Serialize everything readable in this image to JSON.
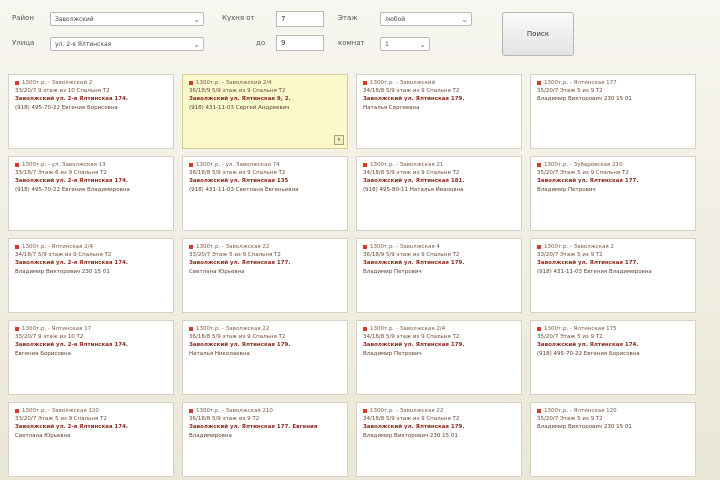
{
  "filters": {
    "row1_label": "Район",
    "row1_value": "Заволжский",
    "row2_label": "Улица",
    "row2_value": "ул. 2-я Ялтинская",
    "area_from_label": "Кухня от",
    "area_from_value": "7",
    "area_to_label": "до",
    "area_to_value": "9",
    "floor_label": "Этаж",
    "floor_value": "любой",
    "rooms_label": "комнат",
    "rooms_value": "1",
    "search_label": "Поиск"
  },
  "cards": [
    {
      "highlighted": false,
      "l1": "1300т.р. - Заволжский 2",
      "l2": "33/20/7 9 этаж из 10 Спальня Т2",
      "l3": "Заволжский ул. 2-я Ялтинская 174.",
      "l4": "(918) 495-70-22 Евгения Борисовна"
    },
    {
      "highlighted": true,
      "l1": "1300т.р. - Заволжский 2/4",
      "l2": "36/18/9 5/9 этаж из 9 Спальня Т2",
      "l3": "Заволжский ул. Ялтинская 9, 2.",
      "l4": "(918) 431-11-03 Сергей Андреевич"
    },
    {
      "highlighted": false,
      "l1": "1300т.р. - Заволжский",
      "l2": "34/18/8 5/9 этаж из 9 Спальня Т2",
      "l3": "Заволжский ул. Ялтинская 179.",
      "l4": "Наталья Сергеевна"
    },
    {
      "highlighted": false,
      "l1": "1300т.р. - Ялтинская 177",
      "l2": "35/20/7 Этаж 5 из 9 Т2",
      "l3": "",
      "l4": "Владимир Викторович 230 15 01"
    },
    {
      "highlighted": false,
      "l1": "1300т.р. - ул. Заволжская 13",
      "l2": "33/18/7 Этаж 6 из 9 Спальня Т2",
      "l3": "Заволжский ул. 2-я Ялтинская 174.",
      "l4": "(918) 495-70-22 Евгения Владимировна"
    },
    {
      "highlighted": false,
      "l1": "1300т.р. - ул. Заволжская 74",
      "l2": "36/18/8 5/9 этаж из 9 Спальня Т2",
      "l3": "Заволжский ул. Ялтинская 135",
      "l4": "(918) 431-11-03 Светлана Евгеньевна"
    },
    {
      "highlighted": false,
      "l1": "1300т.р. - Заволжская 21",
      "l2": "34/18/8 5/9 этаж из 9 Спальня Т2",
      "l3": "Заволжский ул. Ялтинская 181.",
      "l4": "(918) 495-80-11 Наталья Ивановна"
    },
    {
      "highlighted": false,
      "l1": "1300т.р. - Зубаровская 210",
      "l2": "35/20/7 Этаж 5 из 9 Спальня Т2",
      "l3": "Заволжский ул. Ялтинская 177.",
      "l4": "Владимир Петрович"
    },
    {
      "highlighted": false,
      "l1": "1300т.р. - Ялтинская 2/4",
      "l2": "34/18/7 5/9 этаж из 9 Спальня Т2",
      "l3": "Заволжский ул. 2-я Ялтинская 174.",
      "l4": "Владимир Викторович 230 15 01"
    },
    {
      "highlighted": false,
      "l1": "1300т.р. - Заволжская 22",
      "l2": "33/20/7 Этаж 5 из 9 Спальня Т2",
      "l3": "Заволжский ул. Ялтинская 177.",
      "l4": "Светлана Юрьевна"
    },
    {
      "highlighted": false,
      "l1": "1300т.р. - Заволжская 4",
      "l2": "36/18/9 5/9 этаж из 9 Спальня Т2",
      "l3": "Заволжский ул. Ялтинская 179.",
      "l4": "Владимир Петрович"
    },
    {
      "highlighted": false,
      "l1": "1300т.р. - Заволжская 2",
      "l2": "33/20/7 Этаж 5 из 9 Т2",
      "l3": "Заволжский ул. Ялтинская 177.",
      "l4": "(918) 431-11-03 Евгения Владимировна"
    },
    {
      "highlighted": false,
      "l1": "1300т.р. - Ялтинская 17",
      "l2": "33/20/7 9 этаж из 10 Т2",
      "l3": "Заволжский ул. 2-я Ялтинская 174.",
      "l4": "Евгения Борисовна"
    },
    {
      "highlighted": false,
      "l1": "1300т.р. - Заволжская 22",
      "l2": "36/18/8 5/9 этаж из 9 Спальня Т2",
      "l3": "Заволжский ул. Ялтинская 179.",
      "l4": "Наталья Николаевна"
    },
    {
      "highlighted": false,
      "l1": "1300т.р. - Заволжская 2/4",
      "l2": "34/18/8 5/9 этаж из 9 Спальня Т2",
      "l3": "Заволжский ул. Ялтинская 179.",
      "l4": "Владимир Петрович"
    },
    {
      "highlighted": false,
      "l1": "1300т.р. - Ялтинская 175",
      "l2": "35/20/7 Этаж 5 из 9 Т2",
      "l3": "Заволжский ул. Ялтинская 174.",
      "l4": "(918) 495-70-22 Евгения Борисовна"
    },
    {
      "highlighted": false,
      "l1": "1300т.р. - Заволжская 120",
      "l2": "33/20/7 Этаж 5 из 9 Спальня Т2",
      "l3": "Заволжский ул. 2-я Ялтинская 174.",
      "l4": "Светлана Юрьевна"
    },
    {
      "highlighted": false,
      "l1": "1300т.р. - Заволжская 210",
      "l2": "36/18/8 5/9 этаж из 9 Т2",
      "l3": "Заволжский ул. Ялтинская 177. Евгения",
      "l4": "Владимировна"
    },
    {
      "highlighted": false,
      "l1": "1300т.р. - Заволжская 22",
      "l2": "34/18/8 5/9 этаж из 9 Спальня Т2",
      "l3": "Заволжский ул. Ялтинская 179.",
      "l4": "Владимир Викторович 230 15 01"
    },
    {
      "highlighted": false,
      "l1": "1300т.р. - Ялтинская 120",
      "l2": "35/20/7 Этаж 5 из 9 Т2",
      "l3": "",
      "l4": "Владимир Викторович 230 15 01"
    }
  ]
}
